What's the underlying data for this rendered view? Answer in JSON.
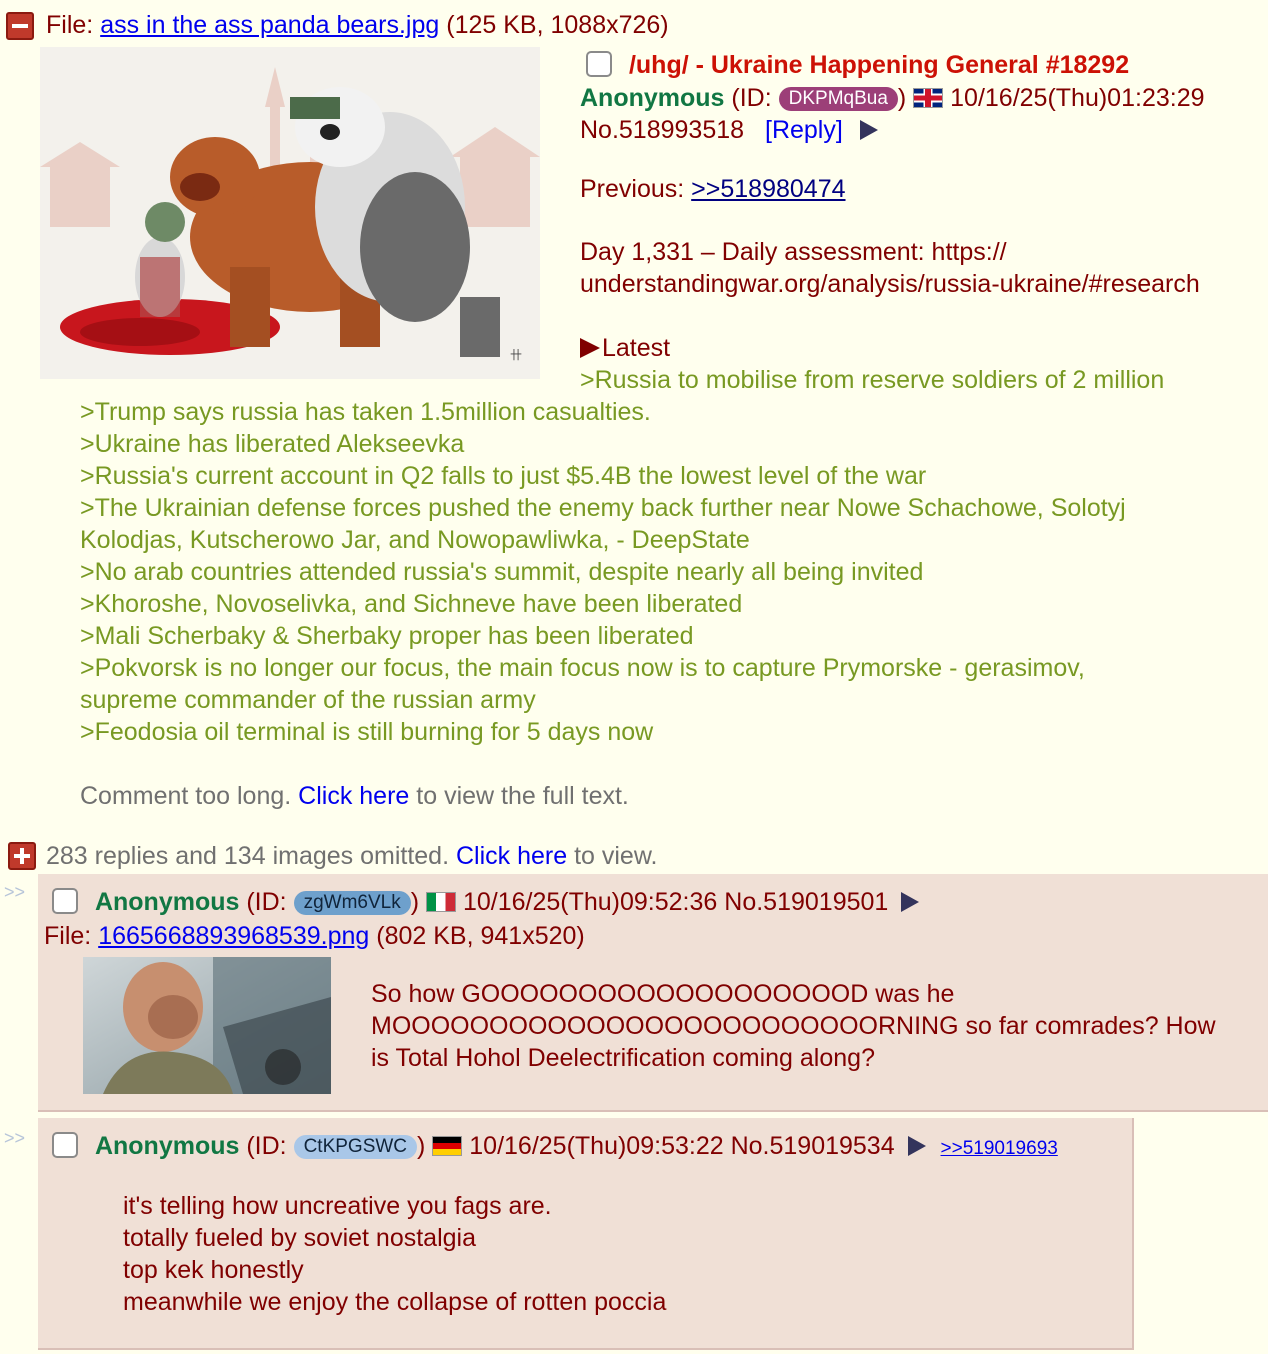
{
  "op": {
    "file_label": "File: ",
    "file_name": "ass in the ass panda bears.jpg",
    "file_info": " (125 KB, 1088x726)",
    "subject": "/uhg/ - Ukraine Happening General #18292",
    "name": "Anonymous",
    "id_prefix": "(ID: ",
    "id": "DKPMqBua",
    "id_suffix": ")",
    "id_color": "#9c3f78",
    "flag": "uk-flag-icon",
    "datetime": "10/16/25(Thu)01:23:29",
    "post_no": "No.518993518",
    "reply_link": "[Reply]",
    "previous_label": "Previous: ",
    "previous_link": ">>518980474",
    "assessment_line1": "Day 1,331 – Daily assessment: https://",
    "assessment_line2": "understandingwar.org/analysis/russia-ukraine/#research",
    "latest_label": "Latest",
    "latest_lines": [
      ">Russia to mobilise from reserve soldiers of 2 million",
      ">Trump says russia has taken 1.5million casualties.",
      ">Ukraine has liberated Alekseevka",
      ">Russia's current account in Q2 falls to just $5.4B the lowest level of the war",
      ">The Ukrainian defense forces pushed the enemy back further near Nowe Schachowe, Solotyj",
      "Kolodjas, Kutscherowo Jar, and Nowopawliwka, - DeepState",
      ">No arab countries attended russia's summit, despite nearly all being invited",
      ">Khoroshe, Novoselivka, and Sichneve have been liberated",
      ">Mali Scherbaky & Sherbaky proper has been liberated",
      ">Pokvorsk is no longer our focus, the main focus now is to capture Prymorske - gerasimov,",
      "supreme commander of the russian army",
      ">Feodosia oil terminal is still burning for 5 days now"
    ],
    "too_long_text": "Comment too long. ",
    "too_long_link": "Click here",
    "too_long_suffix": " to view the full text."
  },
  "omitted": {
    "text": "283 replies and 134 images omitted. ",
    "link": "Click here",
    "suffix": " to view."
  },
  "replies": [
    {
      "marker": ">>",
      "name": "Anonymous",
      "id_prefix": "(ID: ",
      "id": "zgWm6VLk",
      "id_suffix": ")",
      "id_color": "#6ea0cc",
      "flag": "italy-flag-icon",
      "datetime": "10/16/25(Thu)09:52:36",
      "post_no": "No.519019501",
      "file_label": "File: ",
      "file_name": "1665668893968539.png",
      "file_info": " (802 KB, 941x520)",
      "lines": [
        "So how GOOOOOOOOOOOOOOOOOOOD was he",
        "MOOOOOOOOOOOOOOOOOOOOOOOOORNING so far comrades? How",
        "is Total Hohol Deelectrification coming along?"
      ]
    },
    {
      "marker": ">>",
      "name": "Anonymous",
      "id_prefix": "(ID: ",
      "id": "CtKPGSWC",
      "id_suffix": ")",
      "id_color": "#a9c7e8",
      "flag": "germany-flag-icon",
      "datetime": "10/16/25(Thu)09:53:22",
      "post_no": "No.519019534",
      "backlink": ">>519019693",
      "lines": [
        "it's telling how uncreative you fags are.",
        "totally fueled by soviet nostalgia",
        "top kek honestly",
        "meanwhile we enjoy the collapse of rotten poccia"
      ]
    }
  ]
}
